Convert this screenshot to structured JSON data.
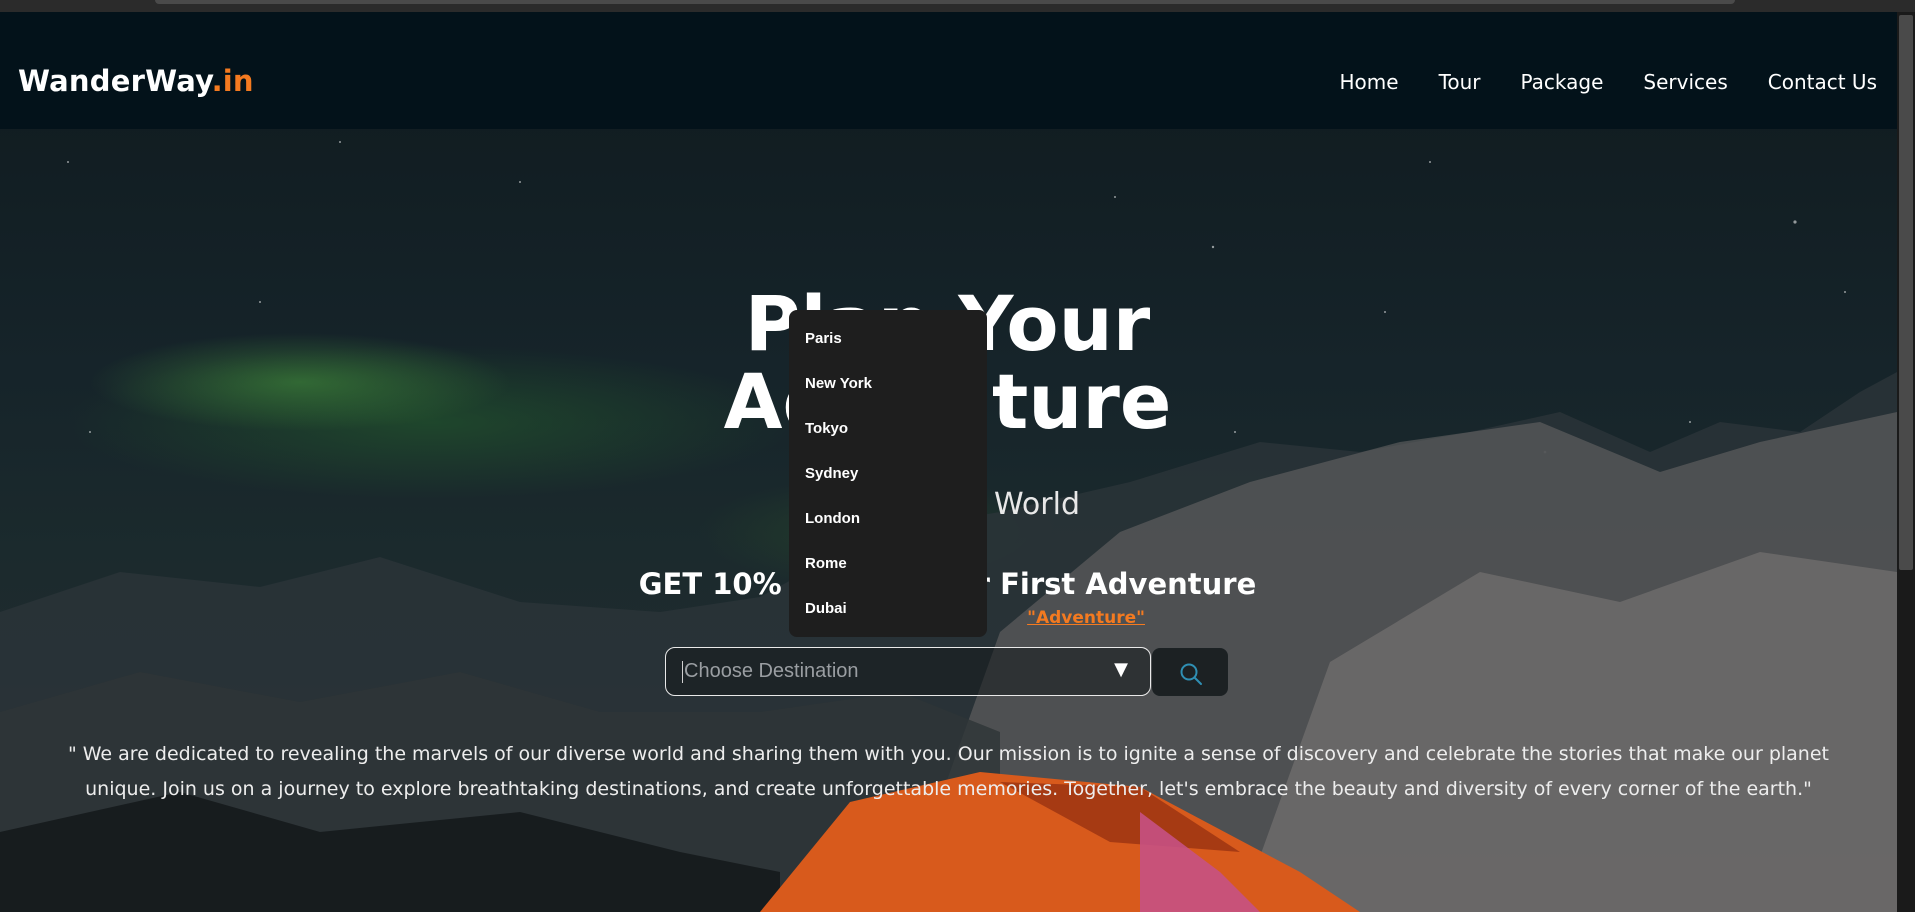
{
  "brand": {
    "name": "WanderWay",
    "suffix": ".in"
  },
  "nav": {
    "items": [
      {
        "label": "Home"
      },
      {
        "label": "Tour"
      },
      {
        "label": "Package"
      },
      {
        "label": "Services"
      },
      {
        "label": "Contact Us"
      }
    ]
  },
  "hero": {
    "title_line1": "Plan Your",
    "title_line2": "Adventure",
    "subtitle": "World",
    "offer": "GET 10% OFF on Your First Adventure",
    "offer_code": "\"Adventure\""
  },
  "search": {
    "placeholder": "Choose Destination",
    "value": "",
    "options": [
      "Paris",
      "New York",
      "Tokyo",
      "Sydney",
      "London",
      "Rome",
      "Dubai"
    ]
  },
  "mission": {
    "text": "\" We are dedicated to revealing the marvels of our diverse world and sharing them with you. Our mission is to ignite a sense of discovery and celebrate the stories that make our planet unique. Join us on a journey to explore breathtaking destinations, and create unforgettable memories. Together, let's embrace the beauty and diversity of every corner of the earth.\""
  },
  "colors": {
    "accent": "#f47a20",
    "navbar_bg": "#03121a",
    "dropdown_bg": "#1e1e1e"
  },
  "icons": {
    "search": "search-icon",
    "dropdown": "dropdown-arrow-icon"
  }
}
